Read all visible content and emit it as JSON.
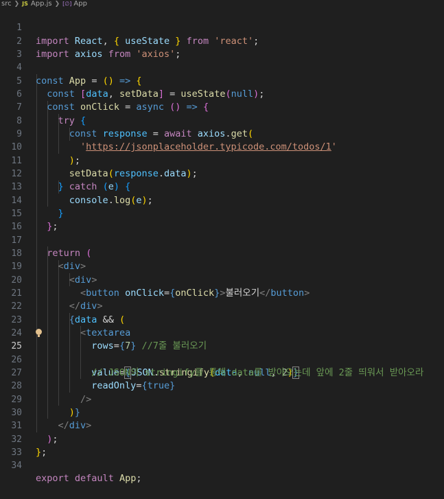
{
  "breadcrumb": {
    "folder": "src",
    "file_badge": "JS",
    "file": "App.js",
    "symbol_badge": "[∅]",
    "symbol": "App"
  },
  "editor": {
    "active_line": 25,
    "line_numbers": [
      "1",
      "2",
      "3",
      "4",
      "5",
      "6",
      "7",
      "8",
      "9",
      "10",
      "11",
      "12",
      "13",
      "14",
      "15",
      "16",
      "17",
      "18",
      "19",
      "20",
      "21",
      "22",
      "23",
      "24",
      "25",
      "26",
      "27",
      "28",
      "29",
      "30",
      "31",
      "32",
      "33",
      "34"
    ],
    "tokens": {
      "import": "import",
      "React": "React",
      "useState": "useState",
      "from": "from",
      "react_str": "'react'",
      "axios": "axios",
      "axios_str": "'axios'",
      "const": "const",
      "App": "App",
      "data": "data",
      "setData": "setData",
      "null": "null",
      "onClick": "onClick",
      "async": "async",
      "try": "try",
      "response": "response",
      "await": "await",
      "get": "get",
      "url": "https://jsonplaceholder.typicode.com/todos/1",
      "catch": "catch",
      "e": "e",
      "console": "console",
      "log": "log",
      "return": "return",
      "div": "div",
      "button": "button",
      "button_text": "불러오기",
      "textarea": "textarea",
      "rows": "rows",
      "rows_val": "7",
      "rows_comment": "//7줄 불러오기",
      "value": "value",
      "JSON": "JSON",
      "stringify": "stringify",
      "two": "2",
      "value_comment": "// JSON의 stringify를 통해 data를 받아오는데 앞에 2줄 띄워서 받아오라",
      "readOnly": "readOnly",
      "true": "true",
      "export": "export",
      "default": "default"
    }
  }
}
